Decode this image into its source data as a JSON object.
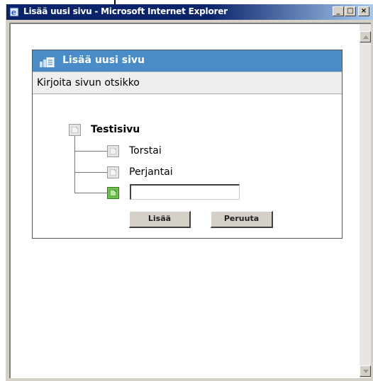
{
  "window": {
    "title": "Lisää uusi sivu - Microsoft Internet Explorer",
    "controls": {
      "minimize": "_",
      "maximize": "□",
      "close": "×"
    }
  },
  "dialog": {
    "header_title": "Lisää uusi sivu",
    "subtitle": "Kirjoita sivun otsikko"
  },
  "tree": {
    "root_label": "Testisivu",
    "children": [
      "Torstai",
      "Perjantai"
    ],
    "new_page_input": {
      "value": "",
      "placeholder": ""
    }
  },
  "buttons": {
    "add_label": "Lisää",
    "cancel_label": "Peruuta"
  },
  "colors": {
    "titlebar": "#0a246a",
    "dialog_header": "#4a8cc8",
    "new_page_icon": "#6cc04a"
  },
  "icons": [
    "internet-explorer-icon",
    "pages-icon",
    "page-icon",
    "new-page-icon",
    "scroll-up-icon",
    "scroll-down-icon"
  ]
}
